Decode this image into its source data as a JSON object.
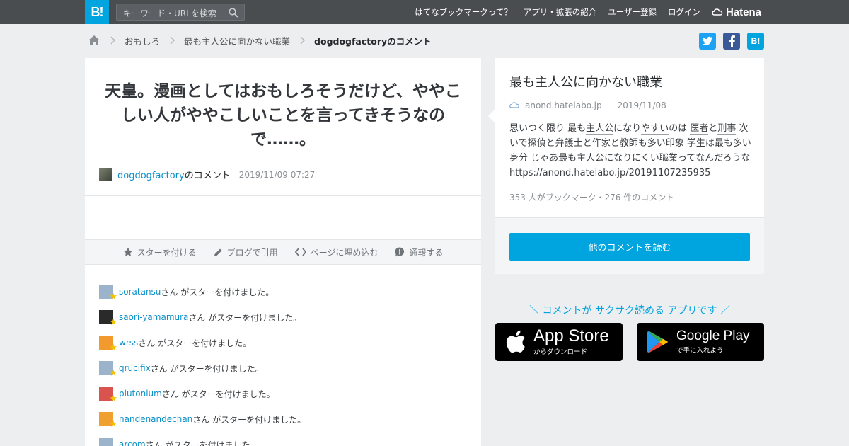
{
  "header": {
    "logo": "B!",
    "search_placeholder": "キーワード・URLを検索",
    "nav": [
      "はてなブックマークって？",
      "アプリ・拡張の紹介",
      "ユーザー登録",
      "ログイン"
    ],
    "brand": "Hatena"
  },
  "breadcrumb": {
    "items": [
      "おもしろ",
      "最も主人公に向かない職業"
    ],
    "current": "dogdogfactoryのコメント"
  },
  "share": {
    "hatena": "B!"
  },
  "comment": {
    "text": "天皇。漫画としてはおもしろそうだけど、ややこしい人がややこしいことを言ってきそうなので……。",
    "user": "dogdogfactory",
    "user_suffix": "のコメント",
    "date": "2019/11/09 07:27"
  },
  "actions": {
    "star": "スターを付ける",
    "blog": "ブログで引用",
    "embed": "ページに埋め込む",
    "report": "通報する"
  },
  "stars_suffix": "さん がスターを付けました。",
  "stars": [
    {
      "user": "soratansu",
      "color": "#9bb4cc"
    },
    {
      "user": "saori-yamamura",
      "color": "#2a2a2a"
    },
    {
      "user": "wrss",
      "color": "#f39a2e"
    },
    {
      "user": "qrucifix",
      "color": "#9bb4cc"
    },
    {
      "user": "plutonium",
      "color": "#d9534f"
    },
    {
      "user": "nandenandechan",
      "color": "#f0a030"
    },
    {
      "user": "arcom",
      "color": "#9bb4cc"
    }
  ],
  "entry": {
    "title": "最も主人公に向かない職業",
    "domain": "anond.hatelabo.jp",
    "date": "2019/11/08",
    "body": [
      {
        "t": "思いつく限り 最も"
      },
      {
        "t": "主人公",
        "k": true
      },
      {
        "t": "になり"
      },
      {
        "t": "やすい",
        "k": true
      },
      {
        "t": "のは "
      },
      {
        "t": "医者",
        "k": true
      },
      {
        "t": "と"
      },
      {
        "t": "刑事",
        "k": true
      },
      {
        "t": " 次いで"
      },
      {
        "t": "探偵",
        "k": true
      },
      {
        "t": "と"
      },
      {
        "t": "弁護士",
        "k": true
      },
      {
        "t": "と"
      },
      {
        "t": "作家",
        "k": true
      },
      {
        "t": "と教師も多い印象 "
      },
      {
        "t": "学生",
        "k": true
      },
      {
        "t": "は最も多い"
      },
      {
        "t": "身分",
        "k": true
      },
      {
        "t": " じゃあ最も"
      },
      {
        "t": "主人公",
        "k": true
      },
      {
        "t": "になりにくい"
      },
      {
        "t": "職業",
        "k": true
      },
      {
        "t": "ってなんだろうな https://anond.hatelabo.jp/20191107235935"
      }
    ],
    "count": "353 人がブックマーク・276 件のコメント",
    "more_button": "他のコメントを読む"
  },
  "app": {
    "promo": "＼ コメントが サクサク読める アプリです ／",
    "appstore_big": "App Store",
    "appstore_small": "からダウンロード",
    "googleplay_big": "Google Play",
    "googleplay_small": "で手に入れよう"
  }
}
